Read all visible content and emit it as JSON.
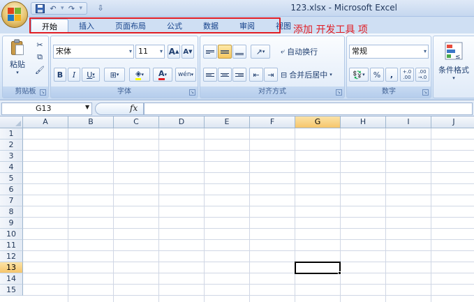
{
  "window": {
    "title": "123.xlsx - Microsoft Excel"
  },
  "qat": {
    "save_icon": "save-icon",
    "undo_icon": "undo-icon",
    "redo_icon": "redo-icon"
  },
  "tabs": [
    {
      "label": "开始",
      "active": true
    },
    {
      "label": "插入"
    },
    {
      "label": "页面布局"
    },
    {
      "label": "公式"
    },
    {
      "label": "数据"
    },
    {
      "label": "审阅"
    },
    {
      "label": "视图"
    }
  ],
  "annotation": {
    "text": "添加 开发工具 项",
    "color": "#e11d24"
  },
  "ribbon": {
    "clipboard": {
      "paste_label": "粘贴",
      "group_label": "剪贴板"
    },
    "font": {
      "font_name": "宋体",
      "font_size": "11",
      "bold": "B",
      "italic": "I",
      "underline": "U",
      "group_label": "字体",
      "grow": "A",
      "shrink": "A",
      "color_letter": "A",
      "phonetic": "wén"
    },
    "alignment": {
      "wrap_label": "自动换行",
      "merge_label": "合并后居中",
      "group_label": "对齐方式"
    },
    "number": {
      "format": "常规",
      "percent": "%",
      "comma": ",",
      "inc_decimal": "+.0",
      "inc_decimal_sub": ".00",
      "dec_decimal": ".00",
      "dec_decimal_sub": "→.0",
      "group_label": "数字"
    },
    "styles": {
      "conditional_label": "条件格式"
    }
  },
  "formula_bar": {
    "name_box": "G13",
    "fx": "fx",
    "value": ""
  },
  "grid": {
    "columns": [
      "A",
      "B",
      "C",
      "D",
      "E",
      "F",
      "G",
      "H",
      "I",
      "J"
    ],
    "rows": [
      "1",
      "2",
      "3",
      "4",
      "5",
      "6",
      "7",
      "8",
      "9",
      "10",
      "11",
      "12",
      "13",
      "14",
      "15"
    ],
    "selected_column": "G",
    "selected_row": "13"
  }
}
